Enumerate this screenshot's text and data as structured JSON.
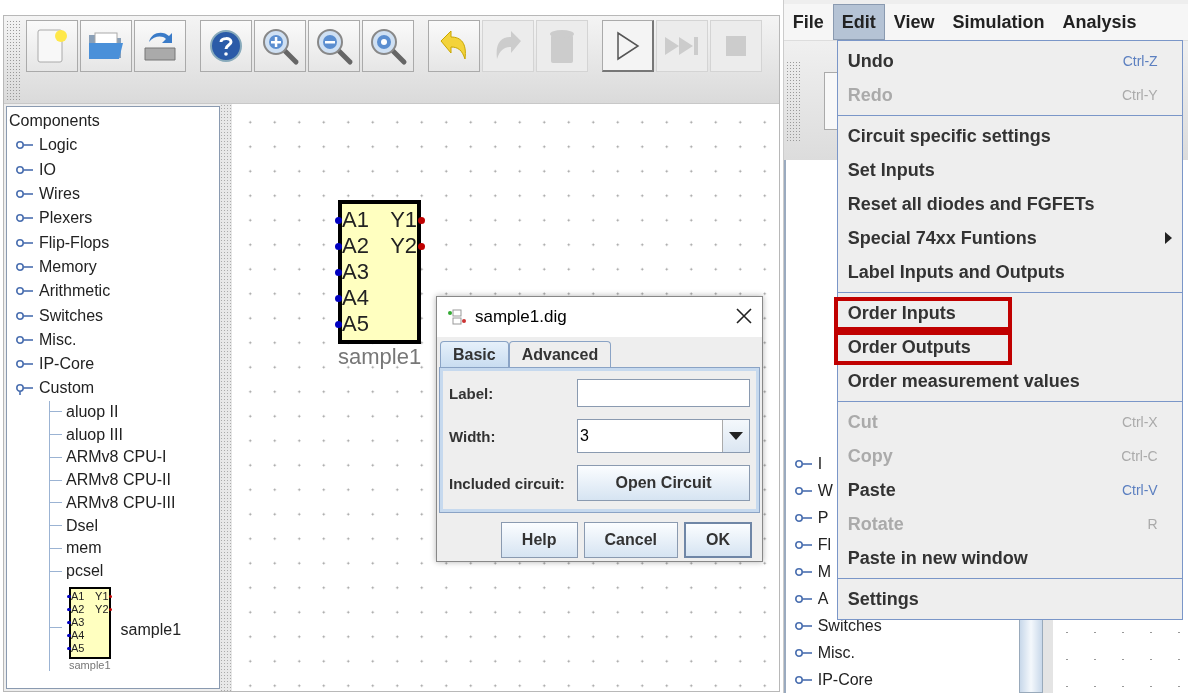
{
  "toolbar": {
    "buttons": [
      {
        "disabled": false
      },
      {
        "disabled": false
      },
      {
        "disabled": false
      },
      {
        "disabled": false
      },
      {
        "disabled": false
      },
      {
        "disabled": false
      },
      {
        "disabled": false
      },
      {
        "disabled": false
      },
      {
        "disabled": true
      },
      {
        "disabled": true
      },
      {
        "disabled": false
      },
      {
        "disabled": true
      },
      {
        "disabled": true
      }
    ]
  },
  "tree": {
    "title": "Components",
    "items": [
      {
        "label": "Logic",
        "expanded": false
      },
      {
        "label": "IO",
        "expanded": false
      },
      {
        "label": "Wires",
        "expanded": false
      },
      {
        "label": "Plexers",
        "expanded": false
      },
      {
        "label": "Flip-Flops",
        "expanded": false
      },
      {
        "label": "Memory",
        "expanded": false
      },
      {
        "label": "Arithmetic",
        "expanded": false
      },
      {
        "label": "Switches",
        "expanded": false
      },
      {
        "label": "Misc.",
        "expanded": false
      },
      {
        "label": "IP-Core",
        "expanded": false
      },
      {
        "label": "Custom",
        "expanded": true,
        "children": [
          {
            "kind": "text",
            "label": "aluop II"
          },
          {
            "kind": "text",
            "label": "aluop III"
          },
          {
            "kind": "text",
            "label": "ARMv8 CPU-I"
          },
          {
            "kind": "text",
            "label": "ARMv8 CPU-II"
          },
          {
            "kind": "text",
            "label": "ARMv8 CPU-III"
          },
          {
            "kind": "text",
            "label": "Dsel"
          },
          {
            "kind": "text",
            "label": "mem"
          },
          {
            "kind": "text",
            "label": "pcsel"
          },
          {
            "kind": "circuit",
            "label": "sample1",
            "preview": {
              "inputs": [
                "A1",
                "A2",
                "A3",
                "A4",
                "A5"
              ],
              "outputs": [
                "Y1",
                "Y2"
              ],
              "caption": "sample1"
            }
          }
        ]
      }
    ]
  },
  "canvas": {
    "component": {
      "inputs": [
        "A1",
        "A2",
        "A3",
        "A4",
        "A5"
      ],
      "outputs": [
        "Y1",
        "Y2"
      ],
      "label": "sample1"
    }
  },
  "dialog": {
    "title": "sample1.dig",
    "tabs": [
      {
        "label": "Basic",
        "selected": true
      },
      {
        "label": "Advanced",
        "selected": false
      }
    ],
    "fields": [
      {
        "kind": "text",
        "label": "Label:"
      },
      {
        "kind": "select",
        "label": "Width:",
        "value": "3"
      },
      {
        "kind": "button",
        "label": "Included circuit:",
        "button": "Open Circuit"
      }
    ],
    "buttons": [
      {
        "label": "Help",
        "default": false
      },
      {
        "label": "Cancel",
        "default": false
      },
      {
        "label": "OK",
        "default": true
      }
    ]
  },
  "second_window": {
    "menu_bar": [
      {
        "label": "File",
        "selected": false
      },
      {
        "label": "Edit",
        "selected": true
      },
      {
        "label": "View",
        "selected": false
      },
      {
        "label": "Simulation",
        "selected": false
      },
      {
        "label": "Analysis",
        "selected": false
      }
    ],
    "menu_groups": [
      [
        {
          "label": "Undo",
          "shortcut": "Ctrl-Z",
          "disabled": false
        },
        {
          "label": "Redo",
          "shortcut": "Ctrl-Y",
          "disabled": true
        }
      ],
      [
        {
          "label": "Circuit specific settings",
          "disabled": false
        },
        {
          "label": "Set Inputs",
          "disabled": false
        },
        {
          "label": "Reset all diodes and FGFETs",
          "disabled": false
        },
        {
          "label": "Special 74xx Funtions",
          "disabled": false,
          "submenu": true
        },
        {
          "label": "Label Inputs and Outputs",
          "disabled": false
        }
      ],
      [
        {
          "label": "Order Inputs",
          "disabled": false,
          "highlighted": true
        },
        {
          "label": "Order Outputs",
          "disabled": false,
          "highlighted": true
        },
        {
          "label": "Order measurement values",
          "disabled": false
        }
      ],
      [
        {
          "label": "Cut",
          "shortcut": "Ctrl-X",
          "disabled": true
        },
        {
          "label": "Copy",
          "shortcut": "Ctrl-C",
          "disabled": true
        },
        {
          "label": "Paste",
          "shortcut": "Ctrl-V",
          "disabled": false
        },
        {
          "label": "Rotate",
          "shortcut": "R",
          "disabled": true
        },
        {
          "label": "Paste in new window",
          "disabled": false
        }
      ],
      [
        {
          "label": "Settings",
          "disabled": false
        }
      ]
    ],
    "tree_behind": [
      "I",
      "W",
      "P",
      "Fl",
      "M",
      "A",
      "Switches",
      "Misc.",
      "IP-Core"
    ]
  }
}
